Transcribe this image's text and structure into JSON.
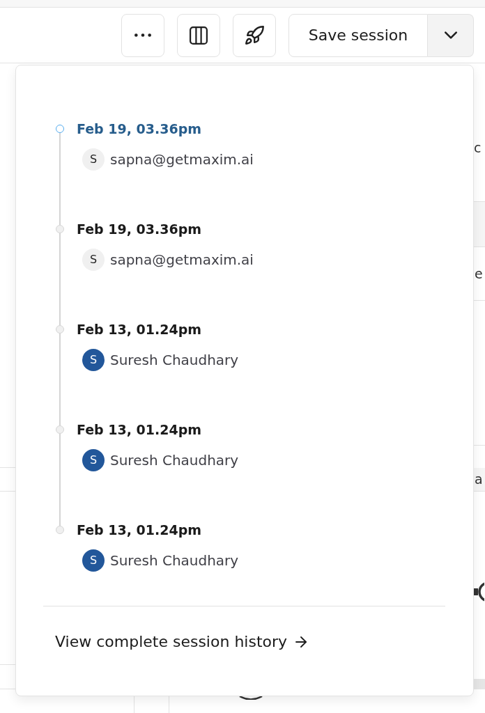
{
  "toolbar": {
    "save_button": {
      "label": "Save session"
    },
    "menu_toggle": {
      "expanded": true
    }
  },
  "history_menu": {
    "entries": [
      {
        "timestamp": "Feb 19, 03.36pm",
        "selected": true,
        "user": {
          "initial": "S",
          "name": "sapna@getmaxim.ai",
          "color": "#f0f0f0"
        }
      },
      {
        "timestamp": "Feb 19, 03.36pm",
        "selected": false,
        "user": {
          "initial": "S",
          "name": "sapna@getmaxim.ai",
          "color": "#f0f0f0"
        }
      },
      {
        "timestamp": "Feb 13, 01.24pm",
        "selected": false,
        "user": {
          "initial": "S",
          "name": "Suresh Chaudhary",
          "color": "#22579a"
        }
      },
      {
        "timestamp": "Feb 13, 01.24pm",
        "selected": false,
        "user": {
          "initial": "S",
          "name": "Suresh Chaudhary",
          "color": "#22579a"
        }
      },
      {
        "timestamp": "Feb 13, 01.24pm",
        "selected": false,
        "user": {
          "initial": "S",
          "name": "Suresh Chaudhary",
          "color": "#22579a"
        }
      }
    ],
    "footer_link": "View complete session history"
  },
  "background_table": {
    "cell_fragments": [
      "c",
      "e",
      "a"
    ]
  }
}
